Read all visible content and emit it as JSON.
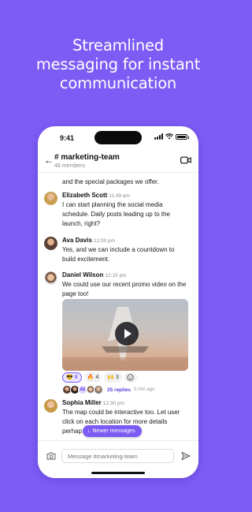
{
  "headline": {
    "line1": "Streamlined",
    "line2": "messaging for instant",
    "line3": "communication"
  },
  "status_bar": {
    "time": "9:41"
  },
  "channel": {
    "name": "# marketing-team",
    "members": "48 members"
  },
  "messages": [
    {
      "text": "and the special packages we offer."
    },
    {
      "name": "Elizabeth Scott",
      "time": "11:49 am",
      "text_lines": [
        "I can start planning the social media",
        "schedule. Daily posts leading up to the",
        "launch, right?"
      ]
    },
    {
      "name": "Ava Davis",
      "time": "12:00 pm",
      "text_lines": [
        "Yes, and we can include a countdown to",
        "build excitement."
      ]
    },
    {
      "name": "Daniel Wilson",
      "time": "12:15 pm",
      "text_lines": [
        "We could use our recent promo video on the",
        "page too!"
      ]
    },
    {
      "name": "Sophia Miller",
      "time": "12:30 pm",
      "text_lines": [
        "The map could be interactive too. Let user",
        "click on each location for more details",
        "perhap"
      ]
    }
  ],
  "reactions": [
    {
      "emoji": "😎",
      "count": "8"
    },
    {
      "emoji": "🔥",
      "count": "4"
    },
    {
      "emoji": "🙌",
      "count": "3"
    }
  ],
  "add_reaction_icon": "smiley-add-icon",
  "thread": {
    "initials": "AE",
    "replies": "25 replies",
    "ago": "5 min ago"
  },
  "newer_messages": "Newer messages",
  "composer": {
    "placeholder": "Message #marketing-team"
  },
  "colors": {
    "brand": "#7c5cf5",
    "link": "#5b3de0"
  }
}
